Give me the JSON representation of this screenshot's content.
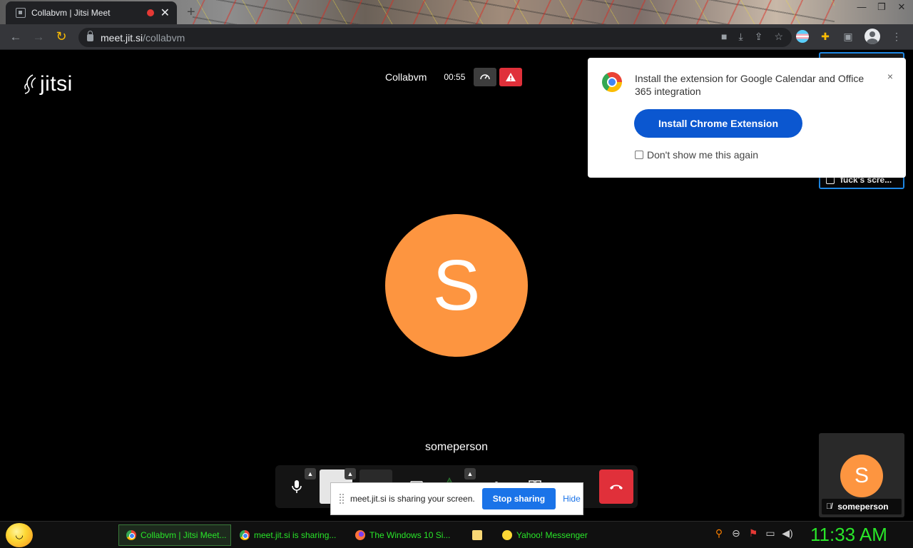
{
  "browser": {
    "tab_title": "Collabvm | Jitsi Meet",
    "url_host": "meet.jit.si",
    "url_path": "/collabvm",
    "icons": [
      "back-icon",
      "forward-icon",
      "reload-icon",
      "camera-icon",
      "install-icon",
      "share-icon",
      "star-icon",
      "extension-icon",
      "sidepanel-icon",
      "profile-icon",
      "menu-icon"
    ]
  },
  "meeting": {
    "logo": "jitsi",
    "name": "Collabvm",
    "timer": "00:55",
    "speaker_initial": "S",
    "speaker_name": "someperson",
    "self_initial": "S",
    "self_name": "someperson",
    "remote_label": "fuck's scre..."
  },
  "popup": {
    "message": "Install the extension for Google Calendar and Office 365 integration",
    "install_label": "Install Chrome Extension",
    "dont_show_label": "Don't show me this again",
    "close_label": "×"
  },
  "sharebar": {
    "message": "meet.jit.si is sharing your screen.",
    "stop_label": "Stop sharing",
    "hide_label": "Hide"
  },
  "taskbar": {
    "items": [
      {
        "label": "Collabvm | Jitsi Meet...",
        "icon": "chrome-icon"
      },
      {
        "label": "meet.jit.si is sharing...",
        "icon": "chrome-icon"
      },
      {
        "label": "The Windows 10 Si...",
        "icon": "firefox-icon"
      },
      {
        "label": "",
        "icon": "folder-icon"
      },
      {
        "label": "Yahoo! Messenger",
        "icon": "yahoo-icon"
      }
    ],
    "clock": "11:33 AM"
  },
  "colors": {
    "avatar": "#fd9540",
    "hangup": "#e0303a",
    "primary_button": "#0b57d0",
    "taskbar_text": "#29e629"
  }
}
